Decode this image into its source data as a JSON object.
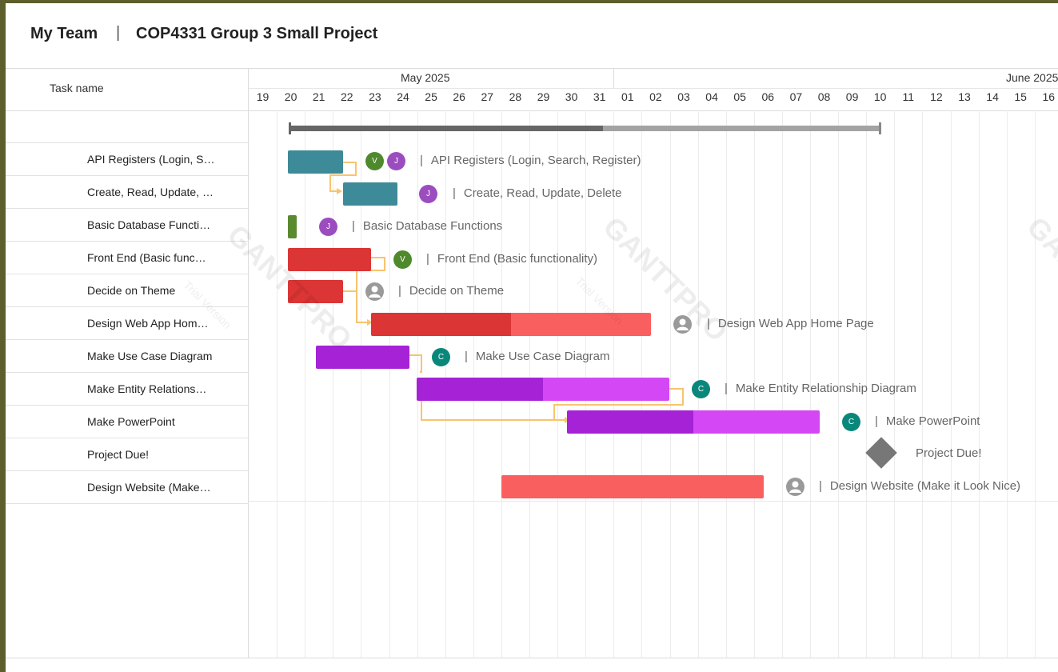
{
  "header": {
    "team": "My Team",
    "separator": "|",
    "project": "COP4331 Group 3 Small Project"
  },
  "table": {
    "task_column": "Task name"
  },
  "timeline": {
    "months": [
      "May 2025",
      "June 2025"
    ],
    "days": [
      "19",
      "20",
      "21",
      "22",
      "23",
      "24",
      "25",
      "26",
      "27",
      "28",
      "29",
      "30",
      "31",
      "01",
      "02",
      "03",
      "04",
      "05",
      "06",
      "07",
      "08",
      "09",
      "10",
      "11",
      "12",
      "13",
      "14",
      "15",
      "16"
    ]
  },
  "tasks": [
    {
      "name": "API Registers (Login, S…",
      "label": "API Registers (Login, Search, Register)",
      "color": "#3d8a98"
    },
    {
      "name": "Create, Read, Update, …",
      "label": "Create, Read, Update, Delete",
      "color": "#3d8a98"
    },
    {
      "name": "Basic Database Functi…",
      "label": "Basic Database Functions",
      "color": "#5a8a30"
    },
    {
      "name": "Front End (Basic func…",
      "label": "Front End (Basic functionality)",
      "color": "#dc3535"
    },
    {
      "name": "Decide on Theme",
      "label": "Decide on Theme",
      "color": "#dc3535"
    },
    {
      "name": "Design Web App Hom…",
      "label": "Design Web App Home Page",
      "color": "#dc3535",
      "progress": 0.5
    },
    {
      "name": "Make Use Case Diagram",
      "label": "Make Use Case Diagram",
      "color": "#a522d6"
    },
    {
      "name": "Make Entity Relations…",
      "label": "Make Entity Relationship Diagram",
      "color": "#a522d6",
      "progress": 0.5
    },
    {
      "name": "Make PowerPoint",
      "label": "Make PowerPoint",
      "color": "#a522d6",
      "progress": 0.5
    },
    {
      "name": "Project Due!",
      "label": "Project Due!",
      "milestone": true
    },
    {
      "name": "Design Website (Make…",
      "label": "Design Website (Make it Look Nice)",
      "color": "#fa5f5f",
      "progress": 0
    }
  ],
  "assignees": {
    "v": "V",
    "j": "J",
    "c": "C"
  },
  "colors": {
    "green": "#4e8a2c",
    "purple": "#9b4dbf",
    "teal": "#0a877b",
    "gray": "#9a9a9a"
  },
  "watermark": {
    "brand": "GANTTPRO",
    "sub": "Trial Version"
  }
}
